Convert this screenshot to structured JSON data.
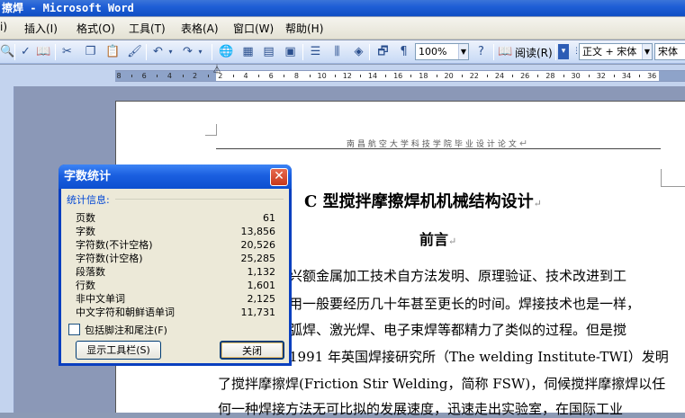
{
  "window": {
    "title": "擦焊 - Microsoft Word"
  },
  "menu": {
    "items": [
      "插入(I)",
      "格式(O)",
      "工具(T)",
      "表格(A)",
      "窗口(W)",
      "帮助(H)"
    ]
  },
  "toolbar": {
    "zoom": "100%",
    "read_label": "阅读(R)",
    "style_value": "正文 + 宋体",
    "font_value": "宋体",
    "left_cut_text": "i)"
  },
  "ruler": {
    "labels": [
      "8",
      "6",
      "4",
      "2",
      "2",
      "4",
      "6",
      "8",
      "10",
      "12",
      "14",
      "16",
      "18",
      "20",
      "22",
      "24",
      "26",
      "28",
      "30",
      "32",
      "34",
      "36"
    ]
  },
  "document": {
    "header": "南昌航空大学科技学院毕业设计论文",
    "title": "C 型搅拌摩擦焊机机械结构设计",
    "preface": "前言",
    "lines": [
      "兴额金属加工技术自方法发明、原理验证、技术改进到工",
      "用一般要经历几十年甚至更长的时间。焊接技术也是一样，",
      "弧焊、激光焊、电子束焊等都精力了类似的过程。但是搅",
      "1991 年英国焊接研究所（The welding Institute-TWI）发明",
      "了搅拌摩擦焊(Friction Stir Welding，简称 FSW)，伺候搅拌摩擦焊以任",
      "何一种焊接方法无可比拟的发展速度，迅速走出实验室，在国际工业"
    ]
  },
  "dialog": {
    "title": "字数统计",
    "section_label": "统计信息:",
    "stats": [
      {
        "label": "页数",
        "value": "61"
      },
      {
        "label": "字数",
        "value": "13,856"
      },
      {
        "label": "字符数(不计空格)",
        "value": "20,526"
      },
      {
        "label": "字符数(计空格)",
        "value": "25,285"
      },
      {
        "label": "段落数",
        "value": "1,132"
      },
      {
        "label": "行数",
        "value": "1,601"
      },
      {
        "label": "非中文单词",
        "value": "2,125"
      },
      {
        "label": "中文字符和朝鲜语单词",
        "value": "11,731"
      }
    ],
    "checkbox_label": "包括脚注和尾注(F)",
    "toolbar_button": "显示工具栏(S)",
    "close_button": "关闭"
  }
}
